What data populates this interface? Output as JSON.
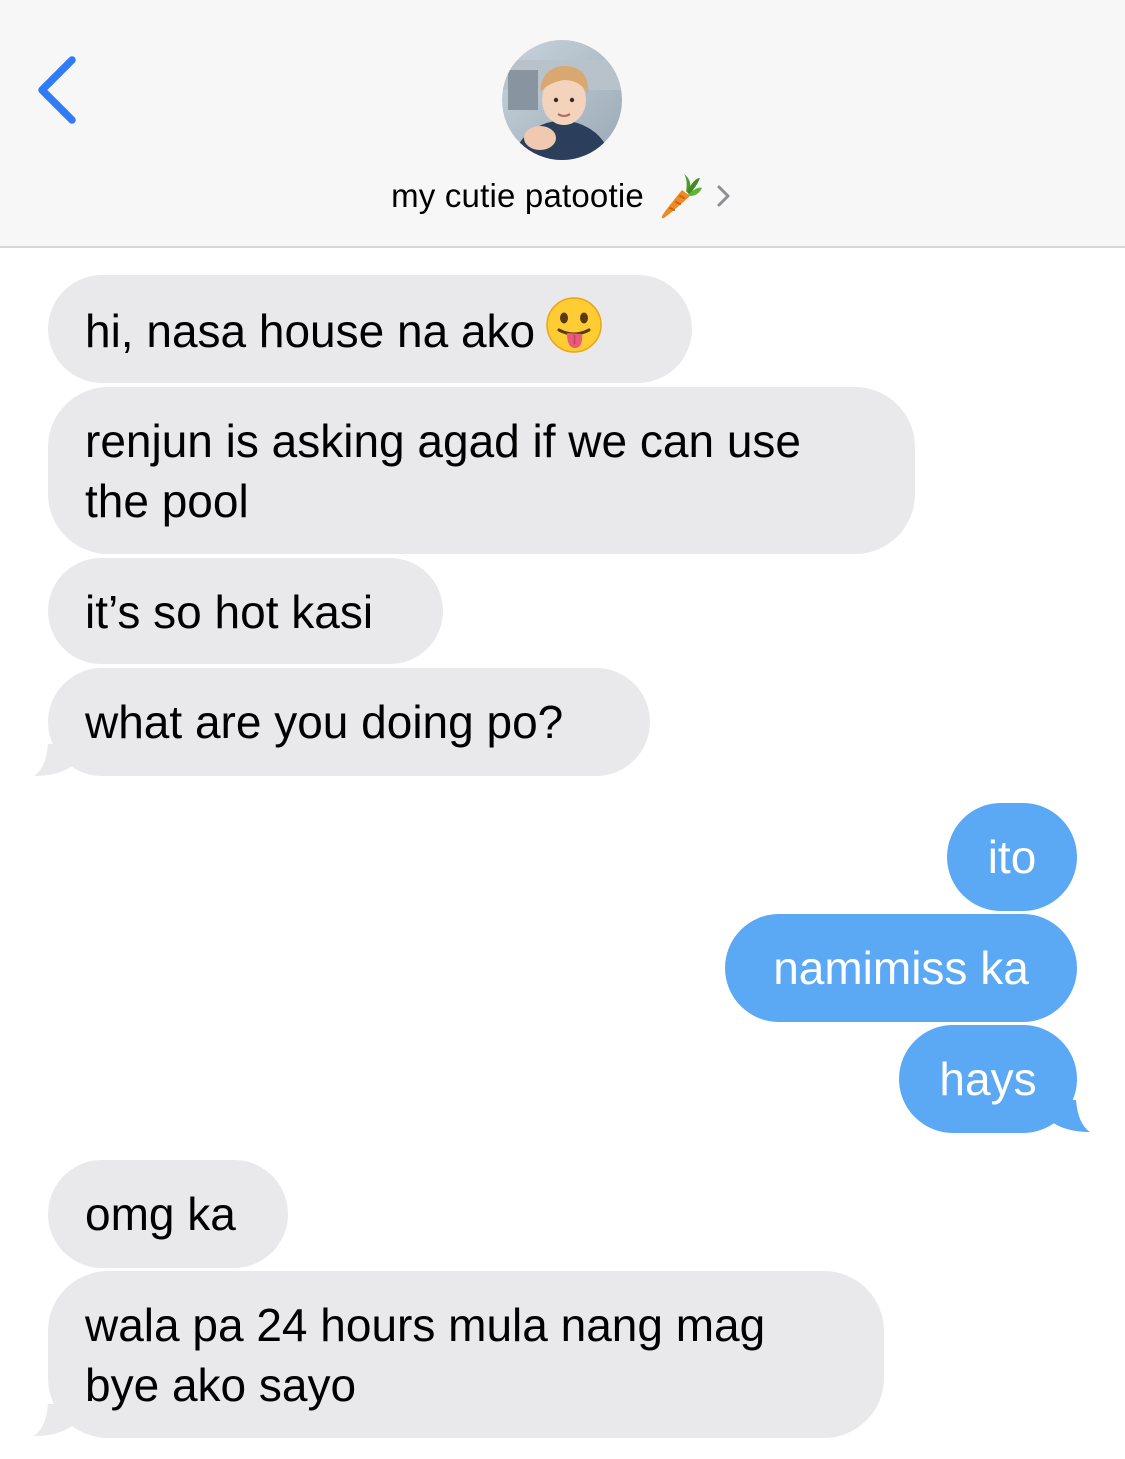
{
  "header": {
    "contact_name": "my cutie patootie",
    "contact_emoji": "carrot-emoji"
  },
  "colors": {
    "header_bg": "#f7f7f7",
    "received_bubble": "#e9e9eb",
    "sent_bubble": "#5ba8f5",
    "accent": "#2f7cf6"
  },
  "messages": [
    {
      "from": "them",
      "text": "hi, nasa house na ako",
      "emoji": "tongue-out-face-emoji"
    },
    {
      "from": "them",
      "line1": "renjun is asking agad if we can use",
      "line2": "the pool"
    },
    {
      "from": "them",
      "text": "it’s so hot kasi"
    },
    {
      "from": "them",
      "text": "what are you doing po?"
    },
    {
      "from": "me",
      "text": "ito"
    },
    {
      "from": "me",
      "text": "namimiss ka"
    },
    {
      "from": "me",
      "text": "hays"
    },
    {
      "from": "them",
      "text": "omg ka"
    },
    {
      "from": "them",
      "line1": "wala pa 24 hours mula nang mag",
      "line2": "bye ako sayo"
    }
  ]
}
